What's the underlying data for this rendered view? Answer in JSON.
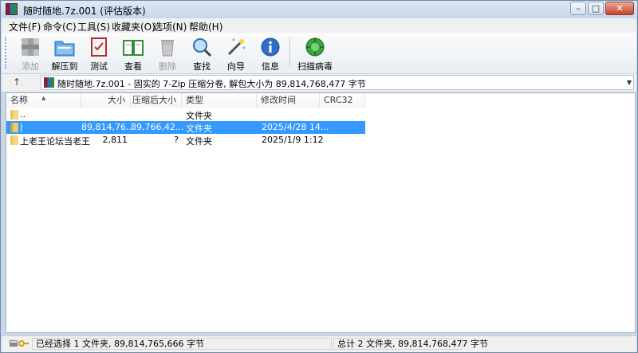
{
  "window": {
    "title": "随时随地.7z.001 (评估版本)",
    "buttons": {
      "minimize": "–",
      "maximize": "□",
      "close": "✕"
    }
  },
  "menu": [
    "文件(F)",
    "命令(C)",
    "工具(S)",
    "收藏夹(O)",
    "选项(N)",
    "帮助(H)"
  ],
  "toolbar": {
    "items": [
      {
        "label": "添加",
        "icon": "add-archive-icon",
        "enabled": false
      },
      {
        "label": "解压到",
        "icon": "extract-to-icon",
        "enabled": true
      },
      {
        "label": "测试",
        "icon": "test-icon",
        "enabled": true
      },
      {
        "label": "查看",
        "icon": "view-book-icon",
        "enabled": true
      },
      {
        "label": "删除",
        "icon": "trash-icon",
        "enabled": false
      },
      {
        "label": "查找",
        "icon": "magnifier-icon",
        "enabled": true
      },
      {
        "label": "向导",
        "icon": "wizard-wand-icon",
        "enabled": true
      },
      {
        "label": "信息",
        "icon": "info-icon",
        "enabled": true
      },
      {
        "label": "扫描病毒",
        "icon": "virus-scan-icon",
        "enabled": true
      }
    ]
  },
  "address": {
    "up_label": "↑",
    "path": "随时随地.7z.001 - 固实的 7-Zip 压缩分卷, 解包大小为 89,814,768,477 字节"
  },
  "columns": [
    "名称",
    "大小",
    "压缩后大小",
    "类型",
    "修改时间",
    "CRC32"
  ],
  "files": [
    {
      "name": "..",
      "size": "",
      "packed": "",
      "type": "文件夹",
      "modified": "",
      "crc": "",
      "selected": false
    },
    {
      "name": "|",
      "size": "89,814,76...",
      "packed": "89,766,42...",
      "type": "文件夹",
      "modified": "2025/4/28 14...",
      "crc": "",
      "selected": true
    },
    {
      "name": "上老王论坛当老王",
      "size": "2,811",
      "packed": "?",
      "type": "文件夹",
      "modified": "2025/1/9 1:12",
      "crc": "",
      "selected": false
    }
  ],
  "status": {
    "left": "已经选择 1 文件夹, 89,814,765,666 字节",
    "right": "总计 2 文件夹, 89,814,768,477 字节"
  },
  "colors": {
    "selection": "#3399ff",
    "chrome": "#c9d7e8"
  }
}
